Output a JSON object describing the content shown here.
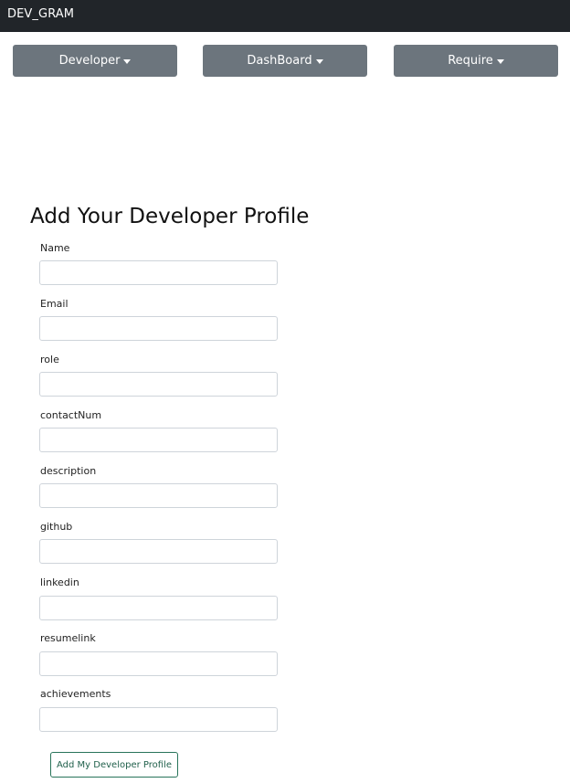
{
  "navbar": {
    "brand": "DEV_GRAM"
  },
  "dropdowns": [
    {
      "label": "Developer"
    },
    {
      "label": "DashBoard"
    },
    {
      "label": "Require"
    }
  ],
  "form": {
    "title": "Add Your Developer Profile",
    "fields": [
      {
        "label": "Name",
        "value": ""
      },
      {
        "label": "Email",
        "value": ""
      },
      {
        "label": "role",
        "value": ""
      },
      {
        "label": "contactNum",
        "value": ""
      },
      {
        "label": "description",
        "value": ""
      },
      {
        "label": "github",
        "value": ""
      },
      {
        "label": "linkedin",
        "value": ""
      },
      {
        "label": "resumelink",
        "value": ""
      },
      {
        "label": "achievements",
        "value": ""
      }
    ],
    "submit_label": "Add My Developer Profile"
  },
  "colors": {
    "navbar_bg": "#212529",
    "dropdown_bg": "#6c757d",
    "submit_border": "#28745a"
  }
}
